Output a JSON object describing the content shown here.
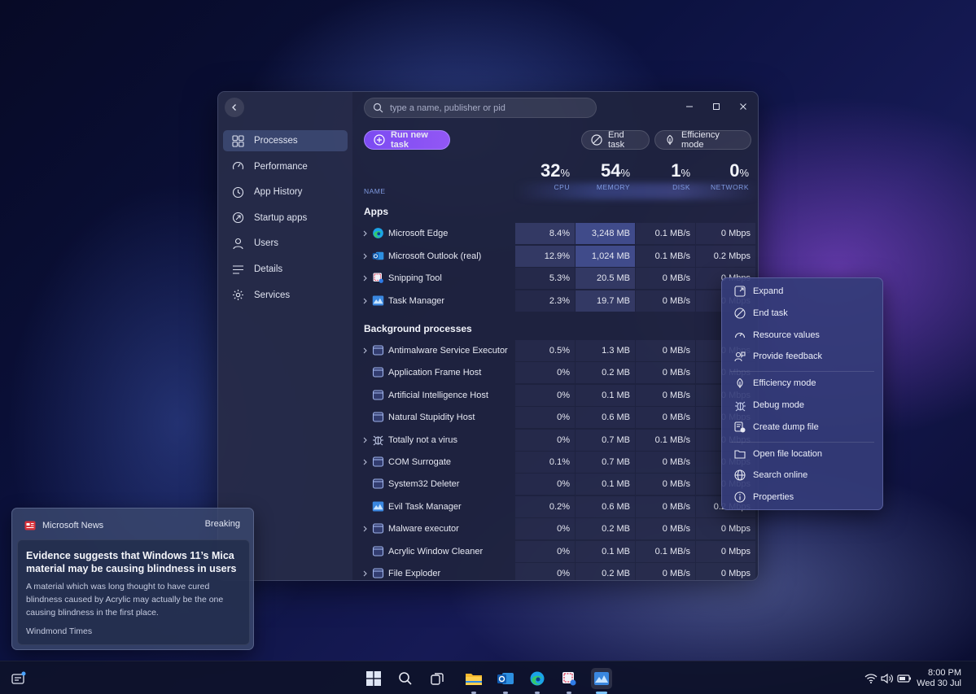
{
  "search": {
    "placeholder": "type a name, publisher or pid"
  },
  "sidebar": {
    "items": [
      {
        "label": "Processes",
        "icon": "processes-grid-icon",
        "active": true
      },
      {
        "label": "Performance",
        "icon": "performance-gauge-icon"
      },
      {
        "label": "App History",
        "icon": "app-history-icon"
      },
      {
        "label": "Startup apps",
        "icon": "startup-apps-icon"
      },
      {
        "label": "Users",
        "icon": "users-icon"
      },
      {
        "label": "Details",
        "icon": "details-list-icon"
      },
      {
        "label": "Services",
        "icon": "services-gear-icon"
      }
    ]
  },
  "toolbar": {
    "run_new_task": "Run new task",
    "end_task": "End task",
    "efficiency_mode": "Efficiency mode"
  },
  "columns": {
    "name": "NAME",
    "cpu": {
      "value": "32",
      "unit": "%",
      "label": "CPU"
    },
    "memory": {
      "value": "54",
      "unit": "%",
      "label": "MEMORY"
    },
    "disk": {
      "value": "1",
      "unit": "%",
      "label": "DISK"
    },
    "network": {
      "value": "0",
      "unit": "%",
      "label": "NETWORK"
    }
  },
  "sections": {
    "apps": "Apps",
    "background": "Background processes"
  },
  "apps": [
    {
      "name": "Microsoft Edge",
      "cpu": "8.4%",
      "memory": "3,248 MB",
      "disk": "0.1 MB/s",
      "network": "0 Mbps",
      "expandable": true,
      "icon": "edge-icon"
    },
    {
      "name": "Microsoft Outlook (real)",
      "cpu": "12.9%",
      "memory": "1,024 MB",
      "disk": "0.1 MB/s",
      "network": "0.2 Mbps",
      "expandable": true,
      "icon": "outlook-icon"
    },
    {
      "name": "Snipping Tool",
      "cpu": "5.3%",
      "memory": "20.5 MB",
      "disk": "0 MB/s",
      "network": "0 Mbps",
      "expandable": true,
      "icon": "snipping-tool-icon"
    },
    {
      "name": "Task Manager",
      "cpu": "2.3%",
      "memory": "19.7 MB",
      "disk": "0 MB/s",
      "network": "0 Mbps",
      "expandable": true,
      "icon": "task-manager-icon"
    }
  ],
  "background": [
    {
      "name": "Antimalware Service Executor",
      "cpu": "0.5%",
      "memory": "1.3 MB",
      "disk": "0 MB/s",
      "network": "0 Mbps",
      "expandable": true,
      "icon": "window-icon"
    },
    {
      "name": "Application Frame Host",
      "cpu": "0%",
      "memory": "0.2 MB",
      "disk": "0 MB/s",
      "network": "0 Mbps",
      "expandable": false,
      "icon": "window-icon"
    },
    {
      "name": "Artificial Intelligence Host",
      "cpu": "0%",
      "memory": "0.1 MB",
      "disk": "0 MB/s",
      "network": "0 Mbps",
      "expandable": false,
      "icon": "window-icon"
    },
    {
      "name": "Natural Stupidity Host",
      "cpu": "0%",
      "memory": "0.6 MB",
      "disk": "0 MB/s",
      "network": "0 Mbps",
      "expandable": false,
      "icon": "window-icon"
    },
    {
      "name": "Totally not a virus",
      "cpu": "0%",
      "memory": "0.7 MB",
      "disk": "0.1 MB/s",
      "network": "0 Mbps",
      "expandable": true,
      "icon": "bug-icon"
    },
    {
      "name": "COM Surrogate",
      "cpu": "0.1%",
      "memory": "0.7 MB",
      "disk": "0 MB/s",
      "network": "0 Mbps",
      "expandable": true,
      "icon": "window-icon"
    },
    {
      "name": "System32 Deleter",
      "cpu": "0%",
      "memory": "0.1 MB",
      "disk": "0 MB/s",
      "network": "0 Mbps",
      "expandable": false,
      "icon": "window-icon"
    },
    {
      "name": "Evil Task Manager",
      "cpu": "0.2%",
      "memory": "0.6 MB",
      "disk": "0 MB/s",
      "network": "0.2 Mbps",
      "expandable": false,
      "icon": "task-manager-icon"
    },
    {
      "name": "Malware executor",
      "cpu": "0%",
      "memory": "0.2 MB",
      "disk": "0 MB/s",
      "network": "0 Mbps",
      "expandable": true,
      "icon": "window-icon"
    },
    {
      "name": "Acrylic Window Cleaner",
      "cpu": "0%",
      "memory": "0.1 MB",
      "disk": "0.1 MB/s",
      "network": "0 Mbps",
      "expandable": false,
      "icon": "window-icon"
    },
    {
      "name": "File Exploder",
      "cpu": "0%",
      "memory": "0.2 MB",
      "disk": "0 MB/s",
      "network": "0 Mbps",
      "expandable": true,
      "icon": "window-icon"
    }
  ],
  "context_menu": {
    "groups": [
      [
        {
          "label": "Expand",
          "icon": "expand-icon"
        },
        {
          "label": "End task",
          "icon": "end-task-icon"
        },
        {
          "label": "Resource values",
          "icon": "gauge-icon"
        },
        {
          "label": "Provide feedback",
          "icon": "feedback-icon"
        }
      ],
      [
        {
          "label": "Efficiency mode",
          "icon": "leaf-icon"
        },
        {
          "label": "Debug mode",
          "icon": "bug-icon"
        },
        {
          "label": "Create dump file",
          "icon": "dump-file-icon"
        }
      ],
      [
        {
          "label": "Open file location",
          "icon": "folder-icon"
        },
        {
          "label": "Search online",
          "icon": "globe-icon"
        },
        {
          "label": "Properties",
          "icon": "info-icon"
        }
      ]
    ]
  },
  "news": {
    "app": "Microsoft News",
    "tag": "Breaking",
    "title": "Evidence suggests that Windows 11’s Mica material may be causing blindness in users",
    "body": "A material which was long thought to have cured blindness caused by Acrylic may actually be the one causing blindness in the first place.",
    "source": "Windmond Times"
  },
  "taskbar": {
    "time": "8:00 PM",
    "date": "Wed 30 Jul",
    "apps": [
      "start-icon",
      "search-icon",
      "task-view-icon",
      "file-explorer-icon",
      "outlook-icon",
      "edge-icon",
      "snipping-tool-icon",
      "task-manager-icon"
    ]
  },
  "colors": {
    "accent": "#8a55f4",
    "cpu_highlight": "#4a5294",
    "memory_highlight": "#4f5fb8"
  }
}
